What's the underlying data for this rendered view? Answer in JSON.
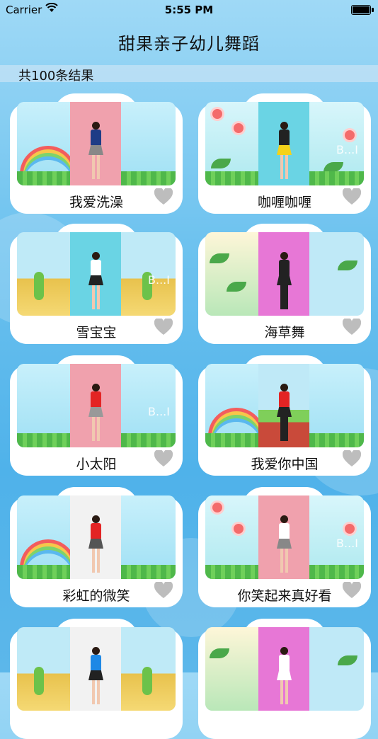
{
  "status_bar": {
    "carrier": "Carrier",
    "time": "5:55 PM"
  },
  "header": {
    "title": "甜果亲子幼儿舞蹈"
  },
  "results": {
    "count_text": "共100条结果"
  },
  "videos": [
    {
      "title": "我爱洗澡"
    },
    {
      "title": "咖喱咖喱"
    },
    {
      "title": "雪宝宝"
    },
    {
      "title": "海草舞"
    },
    {
      "title": "小太阳"
    },
    {
      "title": "我爱你中国"
    },
    {
      "title": "彩虹的微笑"
    },
    {
      "title": "你笑起来真好看"
    },
    {
      "title": ""
    },
    {
      "title": ""
    }
  ],
  "thumbnail_overlay": "B...I",
  "colors": {
    "heart": "#bdbdbd",
    "background": "#5cb7ea"
  },
  "icons": {
    "wifi": "wifi-icon",
    "battery": "battery-icon",
    "favorite": "heart-icon"
  }
}
